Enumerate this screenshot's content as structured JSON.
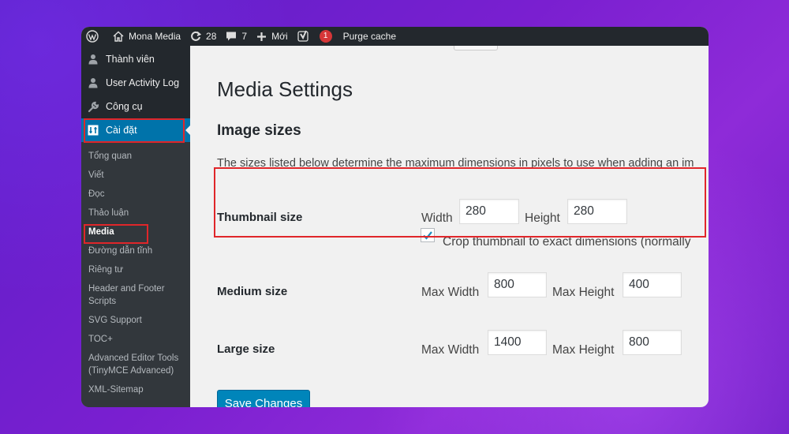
{
  "adminbar": {
    "site_name": "Mona Media",
    "updates_count": "28",
    "comments_count": "7",
    "new_label": "Mới",
    "yoast_badge": "1",
    "purge_label": "Purge cache"
  },
  "sidebar": {
    "items": [
      {
        "label": "Thành viên",
        "icon": "user-icon"
      },
      {
        "label": "User Activity Log",
        "icon": "user-icon"
      },
      {
        "label": "Công cụ",
        "icon": "wrench-icon"
      },
      {
        "label": "Cài đặt",
        "icon": "settings-icon"
      }
    ],
    "submenu": [
      "Tổng quan",
      "Viết",
      "Đọc",
      "Thảo luận",
      "Media",
      "Đường dẫn tĩnh",
      "Riêng tư",
      "Header and Footer Scripts",
      "SVG Support",
      "TOC+",
      "Advanced Editor Tools (TinyMCE Advanced)",
      "XML-Sitemap"
    ]
  },
  "main": {
    "title": "Media Settings",
    "section_title": "Image sizes",
    "description": "The sizes listed below determine the maximum dimensions in pixels to use when adding an im",
    "thumbnail": {
      "label": "Thumbnail size",
      "width_label": "Width",
      "width_value": "280",
      "height_label": "Height",
      "height_value": "280",
      "crop_checked": true,
      "crop_label": "Crop thumbnail to exact dimensions (normally"
    },
    "medium": {
      "label": "Medium size",
      "width_label": "Max Width",
      "width_value": "800",
      "height_label": "Max Height",
      "height_value": "400"
    },
    "large": {
      "label": "Large size",
      "width_label": "Max Width",
      "width_value": "1400",
      "height_label": "Max Height",
      "height_value": "800"
    },
    "save_label": "Save Changes"
  },
  "colors": {
    "admin_dark": "#23282d",
    "submenu_bg": "#32373c",
    "accent_blue": "#0073aa",
    "button_blue": "#0085ba",
    "highlight_red": "#e0262a",
    "background_purple": "#6a1fcc"
  }
}
